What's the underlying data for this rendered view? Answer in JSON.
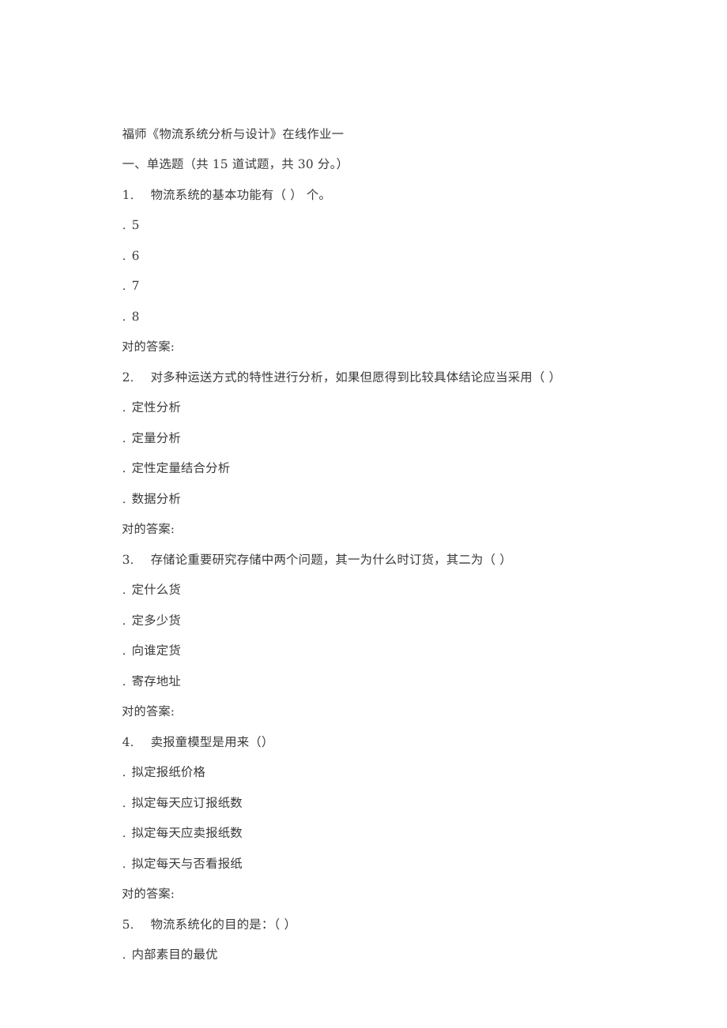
{
  "document": {
    "title": "福师《物流系统分析与设计》在线作业一",
    "section_heading": "一、单选题（共 15 道试题，共 30 分。）",
    "answer_label": "对的答案:",
    "option_marker": ".",
    "text_color": "#3a3a3a",
    "background_color": "#ffffff"
  },
  "questions": [
    {
      "number": "1.",
      "text": "物流系统的基本功能有（ ） 个。",
      "options": [
        "5",
        "6",
        "7",
        "8"
      ],
      "answer_label": "对的答案:",
      "answer_value": ""
    },
    {
      "number": "2.",
      "text": "对多种运送方式的特性进行分析，如果但愿得到比较具体结论应当采用（ ）",
      "options": [
        "定性分析",
        "定量分析",
        "定性定量结合分析",
        "数据分析"
      ],
      "answer_label": "对的答案:",
      "answer_value": ""
    },
    {
      "number": "3.",
      "text": "存储论重要研究存储中两个问题，其一为什么时订货，其二为（ ）",
      "options": [
        "定什么货",
        "定多少货",
        "向谁定货",
        "寄存地址"
      ],
      "answer_label": "对的答案:",
      "answer_value": ""
    },
    {
      "number": "4.",
      "text": "卖报童模型是用来（）",
      "options": [
        "拟定报纸价格",
        "拟定每天应订报纸数",
        "拟定每天应卖报纸数",
        "拟定每天与否看报纸"
      ],
      "answer_label": "对的答案:",
      "answer_value": ""
    },
    {
      "number": "5.",
      "text": "物流系统化的目的是：（ ）",
      "options": [
        "内部素目的最优"
      ],
      "answer_label": "",
      "answer_value": ""
    }
  ]
}
